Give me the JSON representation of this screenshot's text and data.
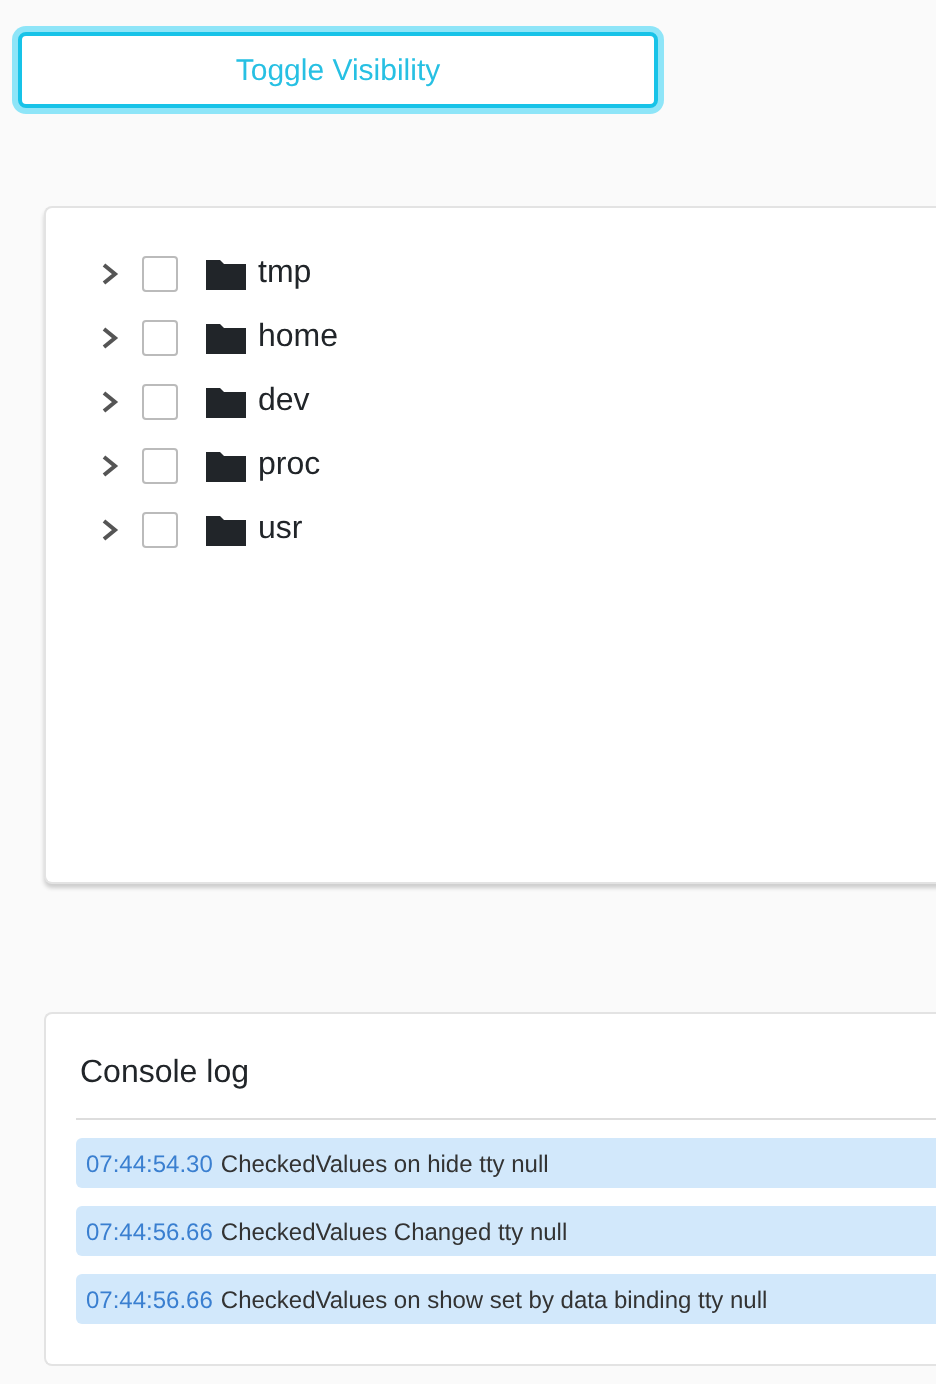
{
  "toggle_button": {
    "label": "Toggle Visibility"
  },
  "tree": {
    "items": [
      {
        "label": "tmp",
        "expanded": false,
        "checked": false
      },
      {
        "label": "home",
        "expanded": false,
        "checked": false
      },
      {
        "label": "dev",
        "expanded": false,
        "checked": false
      },
      {
        "label": "proc",
        "expanded": false,
        "checked": false
      },
      {
        "label": "usr",
        "expanded": false,
        "checked": false
      }
    ]
  },
  "console": {
    "title": "Console log",
    "entries": [
      {
        "time": "07:44:54.30",
        "message": "CheckedValues on hide tty null"
      },
      {
        "time": "07:44:56.66",
        "message": "CheckedValues Changed tty null"
      },
      {
        "time": "07:44:56.66",
        "message": "CheckedValues on show set by data binding tty null"
      }
    ]
  }
}
